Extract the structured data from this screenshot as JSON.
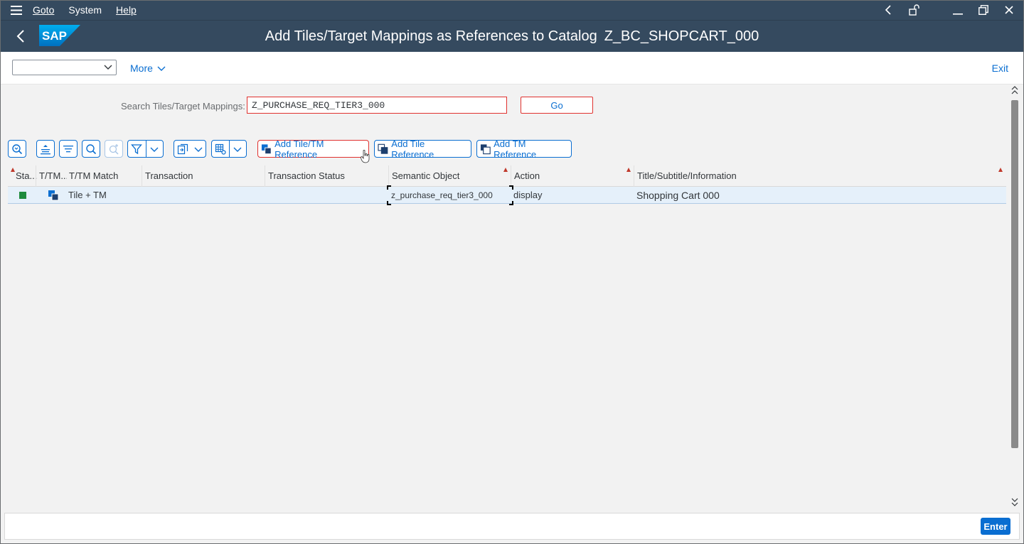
{
  "menu": {
    "items": [
      "Goto",
      "System",
      "Help"
    ]
  },
  "titlebar": {
    "logo": "SAP",
    "title": "Add Tiles/Target Mappings as References to Catalog",
    "catalog": "Z_BC_SHOPCART_000"
  },
  "toolbar": {
    "dropdown_value": "",
    "more_label": "More",
    "exit_label": "Exit"
  },
  "search": {
    "label": "Search Tiles/Target Mappings:",
    "value": "Z_PURCHASE_REQ_TIER3_000",
    "go_label": "Go"
  },
  "actions": {
    "add_tile_tm": "Add Tile/TM Reference",
    "add_tile": "Add Tile Reference",
    "add_tm": "Add TM Reference"
  },
  "table": {
    "columns": [
      "Sta...",
      "T/TM...",
      "T/TM Match",
      "Transaction",
      "Transaction Status",
      "Semantic Object",
      "Action",
      "Title/Subtitle/Information"
    ],
    "rows": [
      {
        "status_color": "#1e8a3c",
        "type_icon": "tile-tm-icon",
        "match": "Tile + TM",
        "transaction": "",
        "transaction_status": "",
        "semantic_object": "z_purchase_req_tier3_000",
        "action": "display",
        "title": "Shopping Cart 000"
      }
    ]
  },
  "footer": {
    "enter_label": "Enter"
  },
  "colors": {
    "shell": "#354a5f",
    "accent": "#0a6ed1",
    "highlight": "#e0312e"
  }
}
